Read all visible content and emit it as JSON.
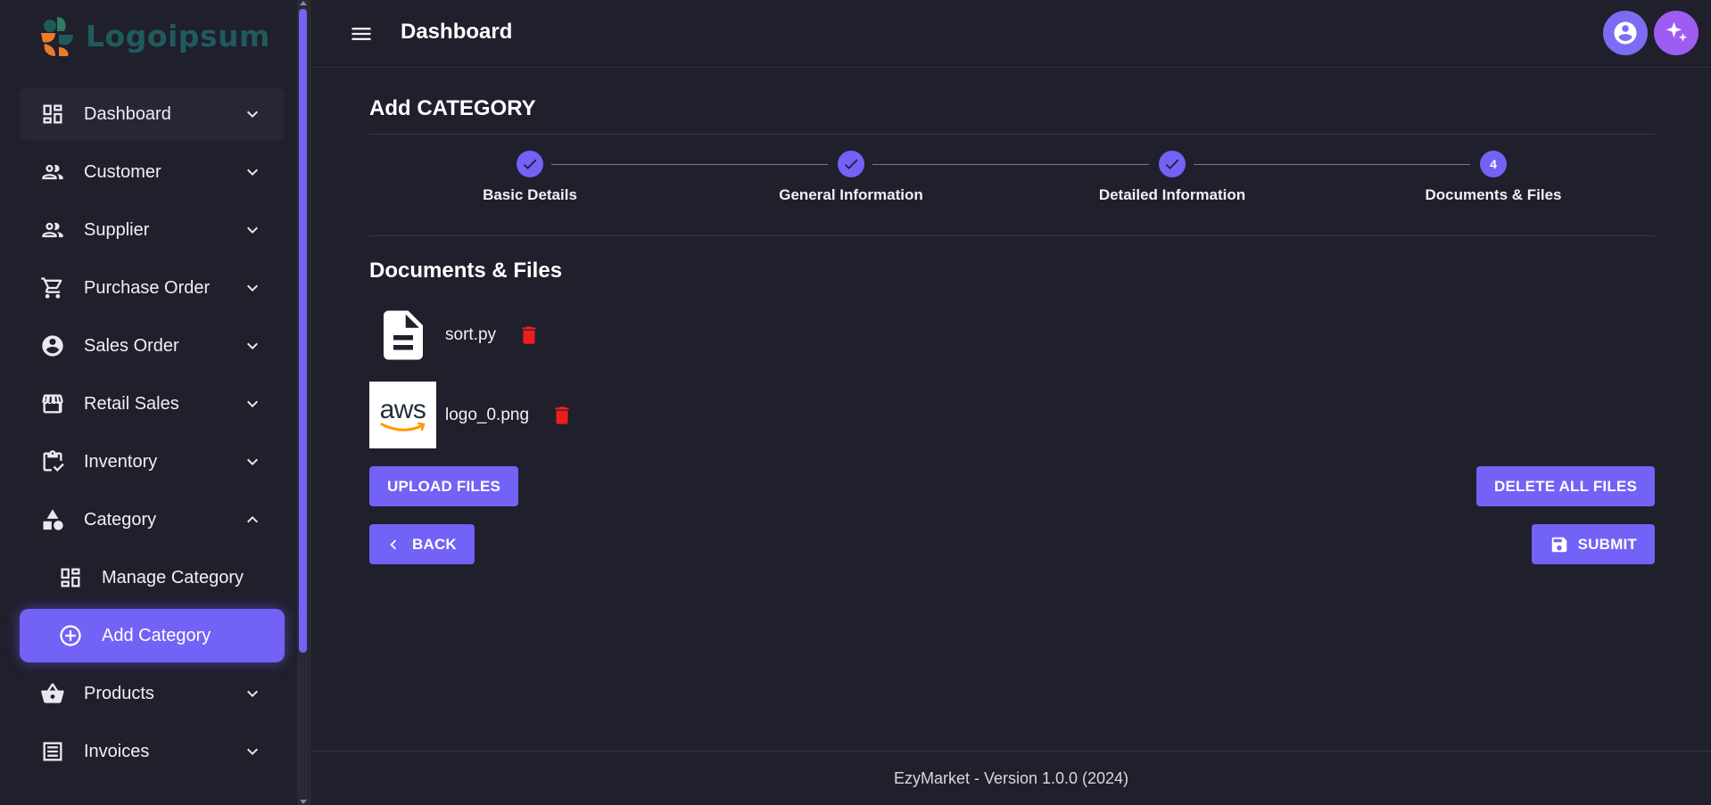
{
  "app": {
    "logo_text": "Logoipsum",
    "header_title": "Dashboard"
  },
  "sidebar": {
    "items": [
      {
        "label": "Dashboard",
        "icon": "dashboard-icon"
      },
      {
        "label": "Customer",
        "icon": "people-icon"
      },
      {
        "label": "Supplier",
        "icon": "people-icon"
      },
      {
        "label": "Purchase Order",
        "icon": "cart-icon"
      },
      {
        "label": "Sales Order",
        "icon": "account-circle-icon"
      },
      {
        "label": "Retail Sales",
        "icon": "store-icon"
      },
      {
        "label": "Inventory",
        "icon": "clipboard-check-icon"
      },
      {
        "label": "Category",
        "icon": "category-icon"
      },
      {
        "label": "Manage Category",
        "icon": "dashboard-icon"
      },
      {
        "label": "Add Category",
        "icon": "add-circle-icon"
      },
      {
        "label": "Products",
        "icon": "basket-icon"
      },
      {
        "label": "Invoices",
        "icon": "receipt-icon"
      }
    ]
  },
  "page": {
    "title": "Add CATEGORY",
    "steps": [
      {
        "label": "Basic Details",
        "status": "done"
      },
      {
        "label": "General Information",
        "status": "done"
      },
      {
        "label": "Detailed Information",
        "status": "done"
      },
      {
        "label": "Documents & Files",
        "status": "active",
        "number": "4"
      }
    ],
    "section_title": "Documents & Files",
    "files": [
      {
        "name": "sort.py",
        "thumb": "document-icon"
      },
      {
        "name": "logo_0.png",
        "thumb_text": "aws"
      }
    ],
    "buttons": {
      "upload": "UPLOAD FILES",
      "delete_all": "DELETE ALL FILES",
      "back": "BACK",
      "submit": "SUBMIT"
    }
  },
  "footer": {
    "text": "EzyMarket - Version 1.0.0 (2024)"
  },
  "colors": {
    "accent": "#7262f6",
    "background": "#201f2c",
    "delete": "#ee1d1d",
    "profile_button": "#7b6cf4",
    "magic_button": "#9d5cf2"
  }
}
